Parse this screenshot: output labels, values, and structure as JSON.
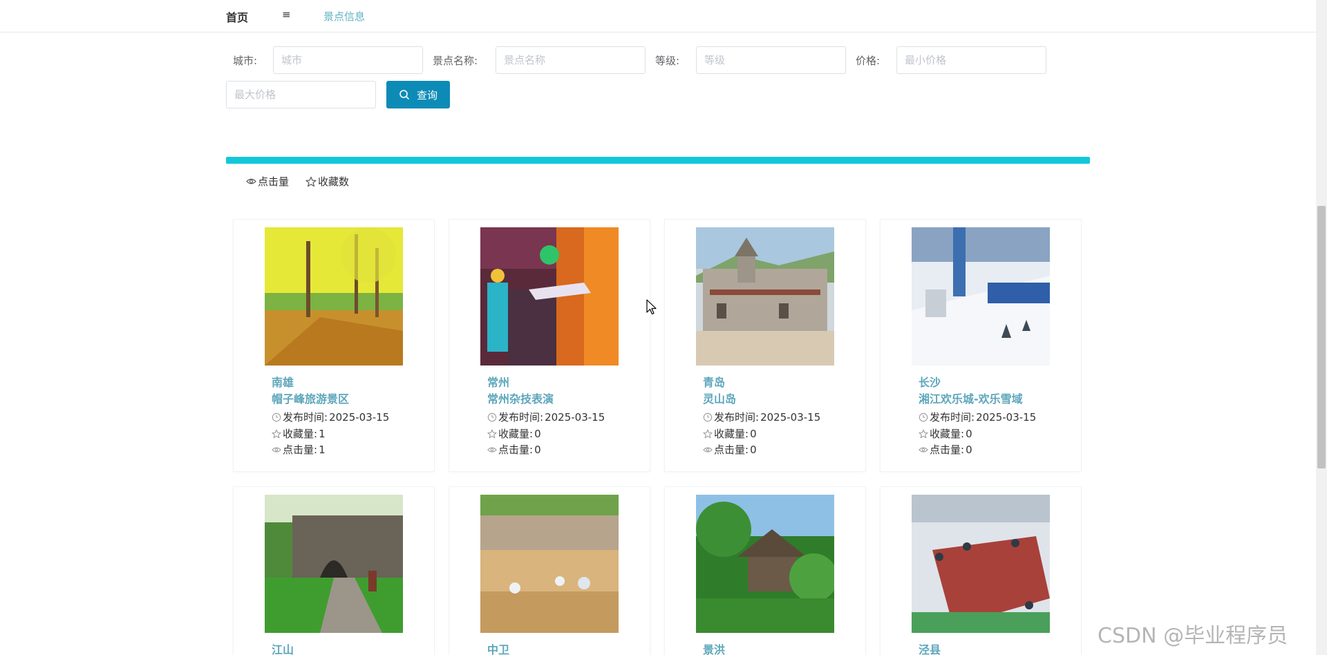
{
  "nav": {
    "home": "首页",
    "menu_icon": "≡",
    "attractions": "景点信息"
  },
  "filters": {
    "city_label": "城市:",
    "city_placeholder": "城市",
    "name_label": "景点名称:",
    "name_placeholder": "景点名称",
    "level_label": "等级:",
    "level_placeholder": "等级",
    "price_label": "价格:",
    "min_price_placeholder": "最小价格",
    "max_price_placeholder": "最大价格",
    "search_label": "查询"
  },
  "sort": {
    "clicks": "点击量",
    "favorites": "收藏数"
  },
  "labels": {
    "published": "发布时间:",
    "favorites": "收藏量:",
    "clicks": "点击量:"
  },
  "cards": [
    {
      "city": "南雄",
      "name": "帽子峰旅游景区",
      "date": "2025-03-15",
      "favorites": "1",
      "clicks": "1"
    },
    {
      "city": "常州",
      "name": "常州杂技表演",
      "date": "2025-03-15",
      "favorites": "0",
      "clicks": "0"
    },
    {
      "city": "青岛",
      "name": "灵山岛",
      "date": "2025-03-15",
      "favorites": "0",
      "clicks": "0"
    },
    {
      "city": "长沙",
      "name": "湘江欢乐城-欢乐雪域",
      "date": "2025-03-15",
      "favorites": "0",
      "clicks": "0"
    },
    {
      "city": "江山"
    },
    {
      "city": "中卫"
    },
    {
      "city": "景洪"
    },
    {
      "city": "泾县"
    }
  ],
  "watermark": "CSDN @毕业程序员"
}
